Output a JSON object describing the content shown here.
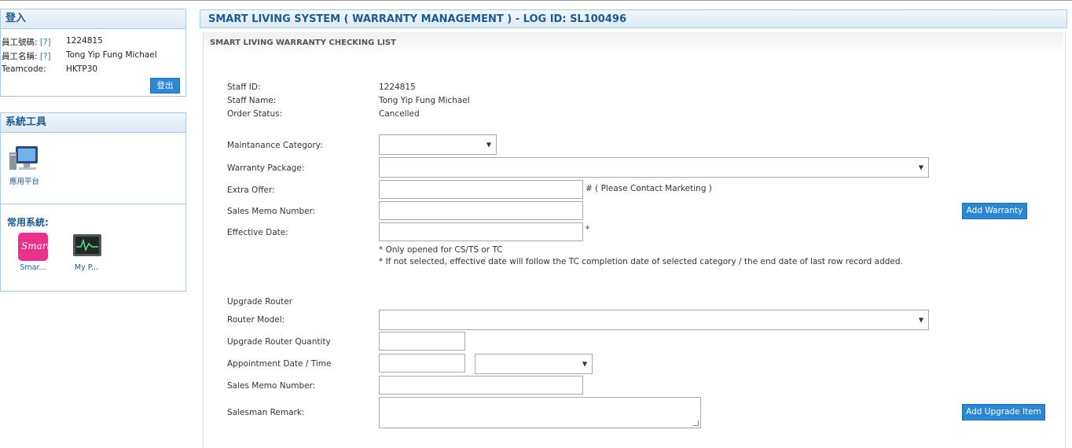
{
  "login_panel": {
    "title": "登入",
    "rows": [
      {
        "label": "員工號碼:",
        "help": "[?]",
        "value": "1224815"
      },
      {
        "label": "員工名稱:",
        "help": "[?]",
        "value": "Tong Yip Fung Michael"
      },
      {
        "label": "Teamcode:",
        "help": "",
        "value": "HKTP30"
      }
    ],
    "logout_label": "登出"
  },
  "tools_panel": {
    "title": "系統工具",
    "app_platform_label": "應用平台",
    "common_title": "常用系統:",
    "apps": [
      {
        "icon": "smart-app-icon",
        "label": "Smar..."
      },
      {
        "icon": "monitor-app-icon",
        "label": "My P..."
      }
    ]
  },
  "main": {
    "title": "SMART LIVING SYSTEM ( WARRANTY MANAGEMENT ) - LOG ID: SL100496",
    "subtitle": "SMART LIVING WARRANTY CHECKING LIST",
    "staff_id_label": "Staff ID:",
    "staff_id": "1224815",
    "staff_name_label": "Staff Name:",
    "staff_name": "Tong Yip Fung Michael",
    "order_status_label": "Order Status:",
    "order_status": "Cancelled",
    "maintenance_label": "Maintanance Category:",
    "warranty_package_label": "Warranty Package:",
    "extra_offer_label": "Extra Offer:",
    "extra_offer_note": "# ( Please Contact Marketing )",
    "memo_label": "Sales Memo Number:",
    "effective_date_label": "Effective Date:",
    "asterisk": "*",
    "note1": "* Only opened for CS/TS or TC",
    "note2": "* If not selected, effective date will follow the TC completion date of selected category / the end date of last row record added.",
    "add_warranty_label": "Add Warranty",
    "upgrade_router_label": "Upgrade Router",
    "router_model_label": "Router Model:",
    "router_qty_label": "Upgrade Router Quantity",
    "appointment_label": "Appointment Date / Time",
    "memo2_label": "Sales Memo Number:",
    "remark_label": "Salesman Remark:",
    "add_upgrade_label": "Add Upgrade Item"
  },
  "colors": {
    "accent": "#2d87d2",
    "header_text": "#1b5a93",
    "border": "#a9cbe5"
  }
}
